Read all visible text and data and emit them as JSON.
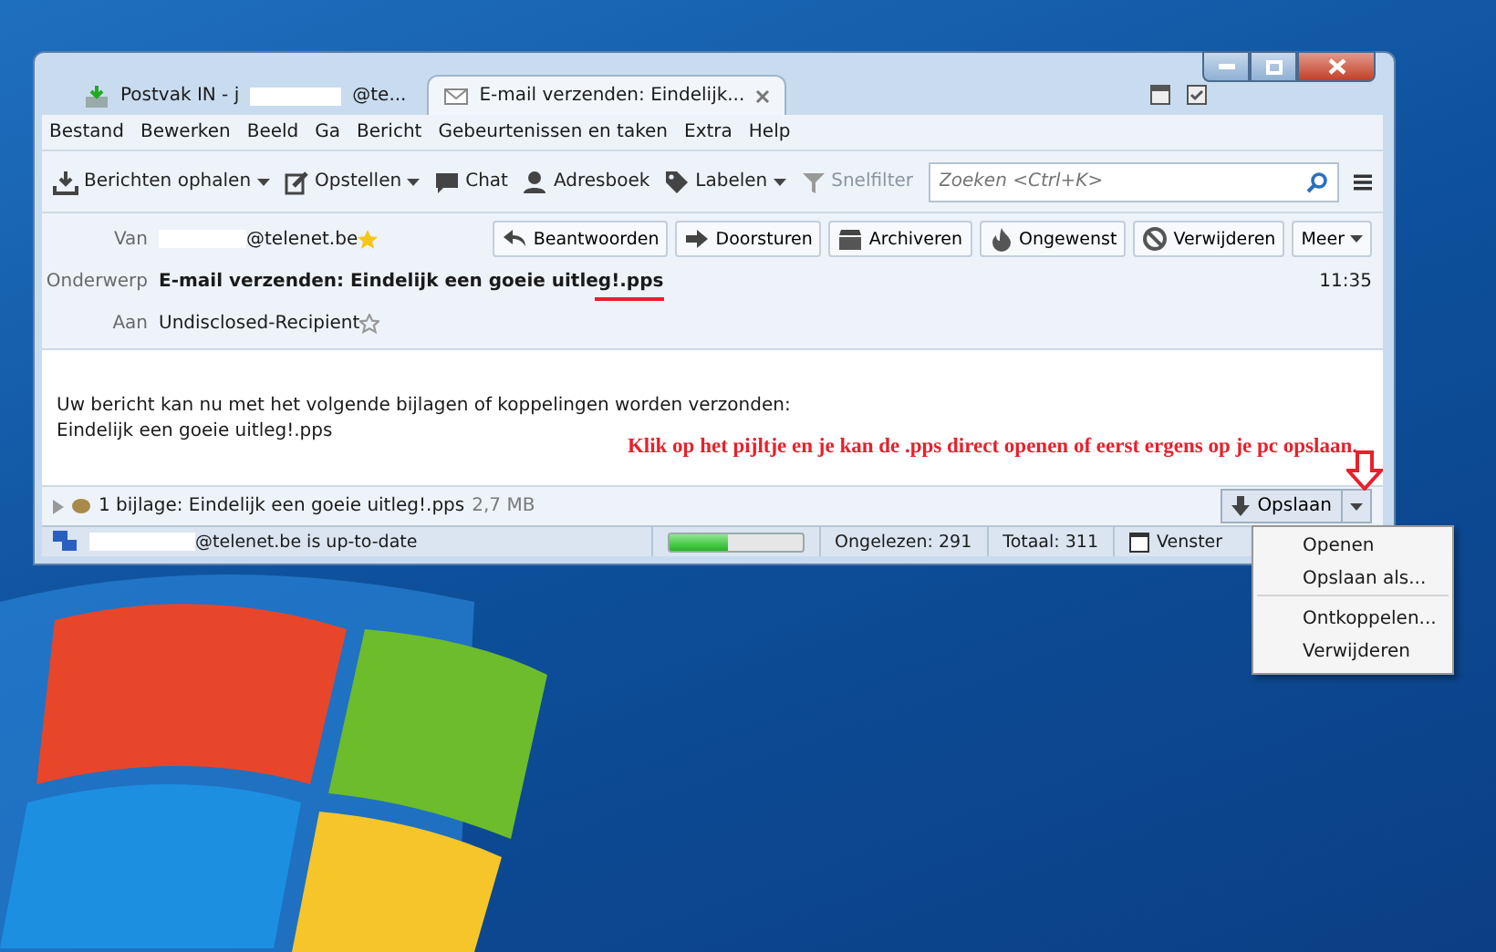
{
  "window": {
    "tabs": [
      {
        "kind": "inbox",
        "label": "Postvak IN - j",
        "label_end": "@te...",
        "selected": false,
        "closable": false
      },
      {
        "kind": "mail",
        "label": "E-mail verzenden: Eindelijk...",
        "selected": true,
        "closable": true
      }
    ]
  },
  "menu_bar": [
    "Bestand",
    "Bewerken",
    "Beeld",
    "Ga",
    "Bericht",
    "Gebeurtenissen en taken",
    "Extra",
    "Help"
  ],
  "toolbar": {
    "buttons": [
      {
        "kind": "download",
        "label": "Berichten ophalen",
        "dropdown": true,
        "disabled": false
      },
      {
        "kind": "compose",
        "label": "Opstellen",
        "dropdown": true,
        "disabled": false
      },
      {
        "kind": "chat",
        "label": "Chat",
        "dropdown": false,
        "disabled": false
      },
      {
        "kind": "contact",
        "label": "Adresboek",
        "dropdown": false,
        "disabled": false
      },
      {
        "kind": "tag",
        "label": "Labelen",
        "dropdown": true,
        "disabled": false
      },
      {
        "kind": "filter",
        "label": "Snelfilter",
        "dropdown": false,
        "disabled": true
      }
    ],
    "search": {
      "placeholder": "Zoeken <Ctrl+K>"
    }
  },
  "header": {
    "from": {
      "label": "Van",
      "value": "@telenet.be"
    },
    "subject": {
      "label": "Onderwerp",
      "value": "E-mail verzenden: Eindelijk een goeie uitleg!.pps"
    },
    "to": {
      "label": "Aan",
      "value": "Undisclosed-Recipient"
    },
    "time": "11:35",
    "actions": [
      {
        "kind": "reply",
        "label": "Beantwoorden"
      },
      {
        "kind": "forward",
        "label": "Doorsturen"
      },
      {
        "kind": "archive",
        "label": "Archiveren"
      },
      {
        "kind": "junk",
        "label": "Ongewenst"
      },
      {
        "kind": "delete",
        "label": "Verwijderen"
      },
      {
        "kind": "more",
        "label": "Meer"
      }
    ]
  },
  "body": [
    "Uw bericht kan nu met het volgende bijlagen of koppelingen worden verzonden:",
    "Eindelijk een goeie uitleg!.pps"
  ],
  "annotation": "Klik op het pijltje en je kan de .pps direct openen of eerst ergens op je pc opslaan.",
  "attachment_bar": {
    "summary": "1 bijlage: Eindelijk een goeie uitleg!.pps",
    "size": "2,7 MB",
    "save_button": "Opslaan"
  },
  "status_bar": {
    "account": "@telenet.be is up-to-date",
    "progress": {
      "level": 0.45
    },
    "unread": "Ongelezen: 291",
    "total": "Totaal: 311",
    "today": "Venster"
  },
  "dropdown_menu": [
    {
      "label": "Openen",
      "separator_after": false
    },
    {
      "label": "Opslaan als...",
      "separator_after": true
    },
    {
      "label": "Ontkoppelen...",
      "separator_after": false
    },
    {
      "label": "Verwijderen",
      "separator_after": false
    }
  ]
}
